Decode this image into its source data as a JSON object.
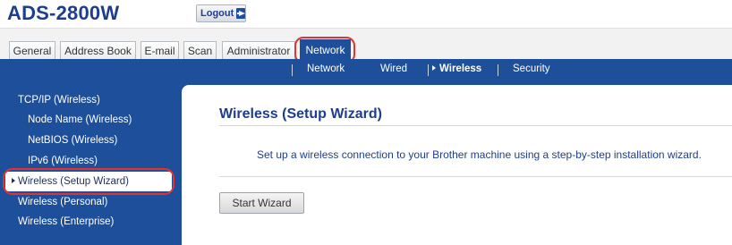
{
  "header": {
    "model": "ADS-2800W",
    "logout_label": "Logout"
  },
  "tabs": [
    {
      "label": "General"
    },
    {
      "label": "Address Book"
    },
    {
      "label": "E-mail"
    },
    {
      "label": "Scan"
    },
    {
      "label": "Administrator"
    },
    {
      "label": "Network",
      "active": true
    }
  ],
  "subnav": [
    {
      "label": "Network"
    },
    {
      "label": "Wired"
    },
    {
      "label": "Wireless",
      "active": true
    },
    {
      "label": "Security"
    }
  ],
  "sidebar": {
    "items": [
      {
        "label": "TCP/IP (Wireless)"
      },
      {
        "label": "Node Name (Wireless)"
      },
      {
        "label": "NetBIOS (Wireless)"
      },
      {
        "label": "IPv6 (Wireless)"
      },
      {
        "label": "Wireless (Setup Wizard)",
        "active": true
      },
      {
        "label": "Wireless (Personal)"
      },
      {
        "label": "Wireless (Enterprise)"
      }
    ]
  },
  "main": {
    "title": "Wireless (Setup Wizard)",
    "description": "Set up a wireless connection to your Brother machine using a step-by-step installation wizard.",
    "button_label": "Start Wizard"
  },
  "colors": {
    "brand_blue": "#1d4f9a",
    "title_blue": "#1d3d8f",
    "highlight_red": "#e2342f"
  }
}
